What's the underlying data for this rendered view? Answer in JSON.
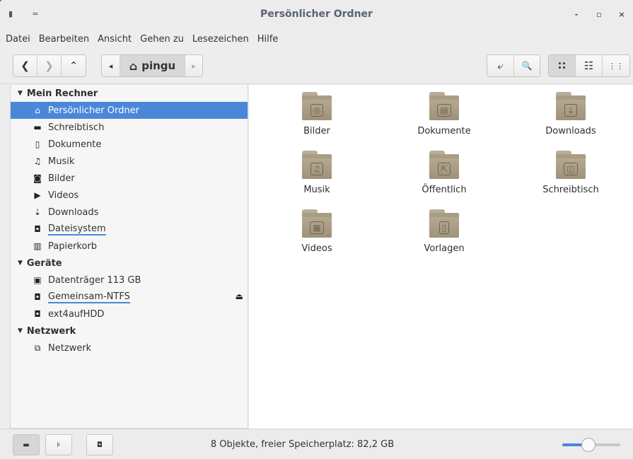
{
  "window": {
    "title": "Persönlicher Ordner",
    "left_controls": [
      "▮",
      "="
    ],
    "controls": {
      "minimize": "-",
      "maximize": "▫",
      "close": "×"
    }
  },
  "menubar": [
    "Datei",
    "Bearbeiten",
    "Ansicht",
    "Gehen zu",
    "Lesezeichen",
    "Hilfe"
  ],
  "toolbar": {
    "back": "❮",
    "forward": "❯",
    "up": "⌃",
    "path_left": "◂",
    "path_home_label": "pingu",
    "path_right": "▸",
    "open_terminal": "⤶",
    "search": "🔍",
    "view_icons": "∷",
    "view_compact": "☷",
    "view_list": "⋮⋮"
  },
  "sidebar": {
    "sections": [
      {
        "label": "Mein Rechner",
        "items": [
          {
            "label": "Persönlicher Ordner",
            "icon": "home-icon",
            "glyph": "⌂",
            "selected": true
          },
          {
            "label": "Schreibtisch",
            "icon": "desktop-folder-icon",
            "glyph": "▬"
          },
          {
            "label": "Dokumente",
            "icon": "document-icon",
            "glyph": "▯"
          },
          {
            "label": "Musik",
            "icon": "music-icon",
            "glyph": "♫"
          },
          {
            "label": "Bilder",
            "icon": "camera-icon",
            "glyph": "◙"
          },
          {
            "label": "Videos",
            "icon": "video-icon",
            "glyph": "▶"
          },
          {
            "label": "Downloads",
            "icon": "download-icon",
            "glyph": "⇣"
          },
          {
            "label": "Dateisystem",
            "icon": "drive-icon",
            "glyph": "◘",
            "usage": true
          },
          {
            "label": "Papierkorb",
            "icon": "trash-icon",
            "glyph": "▥"
          }
        ]
      },
      {
        "label": "Geräte",
        "items": [
          {
            "label": "Datenträger 113 GB",
            "icon": "disk-icon",
            "glyph": "▣"
          },
          {
            "label": "Gemeinsam-NTFS",
            "icon": "drive-icon",
            "glyph": "◘",
            "usage": true,
            "eject": "⏏"
          },
          {
            "label": "ext4aufHDD",
            "icon": "drive-icon",
            "glyph": "◘"
          }
        ]
      },
      {
        "label": "Netzwerk",
        "items": [
          {
            "label": "Netzwerk",
            "icon": "network-icon",
            "glyph": "⧉"
          }
        ]
      }
    ]
  },
  "main": {
    "items": [
      {
        "label": "Bilder",
        "emblem": "◎",
        "icon": "pictures-folder-icon"
      },
      {
        "label": "Dokumente",
        "emblem": "▤",
        "icon": "documents-folder-icon"
      },
      {
        "label": "Downloads",
        "emblem": "⇣",
        "icon": "downloads-folder-icon"
      },
      {
        "label": "Musik",
        "emblem": "♫",
        "icon": "music-folder-icon"
      },
      {
        "label": "Öffentlich",
        "emblem": "⇱",
        "icon": "public-folder-icon"
      },
      {
        "label": "Schreibtisch",
        "emblem": "◫",
        "icon": "desktop-folder-icon"
      },
      {
        "label": "Videos",
        "emblem": "▦",
        "icon": "videos-folder-icon"
      },
      {
        "label": "Vorlagen",
        "emblem": "▯",
        "icon": "templates-folder-icon"
      }
    ]
  },
  "statusbar": {
    "text": "8 Objekte, freier Speicherplatz: 82,2 GB",
    "btn_places": "▬",
    "btn_tree": "⊧",
    "btn_hide": "◘",
    "zoom_level": 0.45
  },
  "colors": {
    "accent": "#4b87d9",
    "folder": "#a89c84"
  }
}
